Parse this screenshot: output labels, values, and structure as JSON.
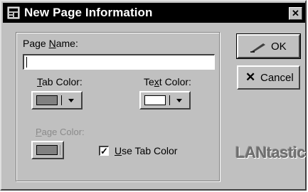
{
  "window": {
    "title": "New Page Information",
    "close_label": "✕"
  },
  "page_name": {
    "label_pre": "Page ",
    "label_ul": "N",
    "label_post": "ame:",
    "value": ""
  },
  "tab_color": {
    "label_pre": "",
    "label_ul": "T",
    "label_post": "ab Color:",
    "swatch": "#808080"
  },
  "text_color": {
    "label_pre": "Te",
    "label_ul": "x",
    "label_post": "t Color:",
    "swatch": "#ffffff"
  },
  "page_color": {
    "label_pre": "",
    "label_ul": "P",
    "label_post": "age Color:",
    "swatch": "#808080",
    "enabled": false
  },
  "use_tab_color": {
    "label_pre": "",
    "label_ul": "U",
    "label_post": "se Tab Color",
    "checked": true,
    "check_glyph": "✓"
  },
  "buttons": {
    "ok_label": "OK",
    "cancel_label": "Cancel"
  },
  "logo": {
    "text": "LANtastic"
  }
}
